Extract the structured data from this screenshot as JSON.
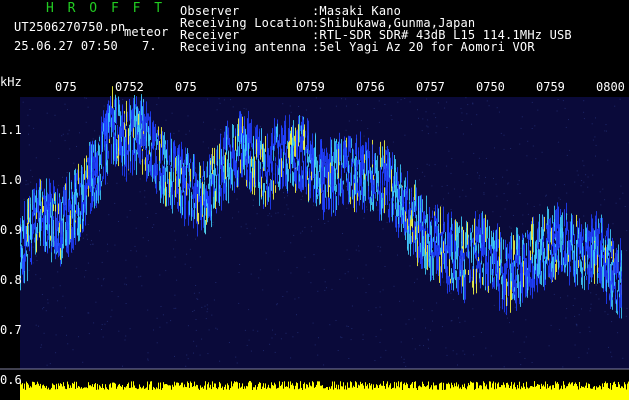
{
  "header": {
    "brand": "H R O F F T",
    "filename": "UT2506270750.pn",
    "meteor_label": "meteor",
    "datetime": "25.06.27 07:50",
    "count": "7.",
    "fields": [
      {
        "label": "Observer",
        "value": ":Masaki Kano"
      },
      {
        "label": "Receiving Location",
        "value": ":Shibukawa,Gunma,Japan"
      },
      {
        "label": "Receiver",
        "value": ":RTL-SDR SDR# 43dB L15 114.1MHz USB"
      },
      {
        "label": "Receiving antenna",
        "value": ":5el Yagi Az 20 for Aomori VOR"
      }
    ]
  },
  "x_axis": {
    "tick_labels": [
      "075",
      "0752",
      "075",
      "075",
      "0759",
      "0756",
      "0757",
      "0750",
      "0759",
      "0800"
    ]
  },
  "y_axis": {
    "unit": "kHz",
    "tick_labels": [
      "1.1",
      "1.0",
      "0.9",
      "0.8",
      "0.7",
      "0.6"
    ]
  },
  "colors": {
    "background": "#000000",
    "plot_background": "#0a0a3a",
    "signal_core": "#ffff40",
    "signal_mid": "#40d0ff",
    "signal_edge": "#2040ff",
    "amplitude_bar": "#ffff00",
    "grid_line": "#8080a0"
  }
}
